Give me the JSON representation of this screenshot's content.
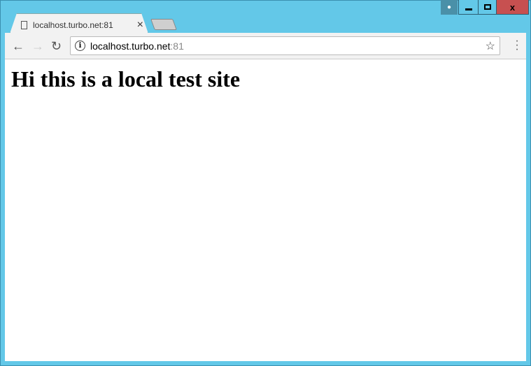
{
  "window": {
    "user_icon": "user-icon",
    "minimize": "minimize-icon",
    "maximize": "maximize-icon",
    "close_label": "x"
  },
  "tab": {
    "title": "localhost.turbo.net:81",
    "close": "×"
  },
  "toolbar": {
    "back": "←",
    "forward": "→",
    "reload": "↻",
    "info": "i",
    "url_host": "localhost.turbo.net",
    "url_port": ":81",
    "star": "☆",
    "menu": "⋮"
  },
  "page": {
    "heading": "Hi this is a local test site"
  }
}
